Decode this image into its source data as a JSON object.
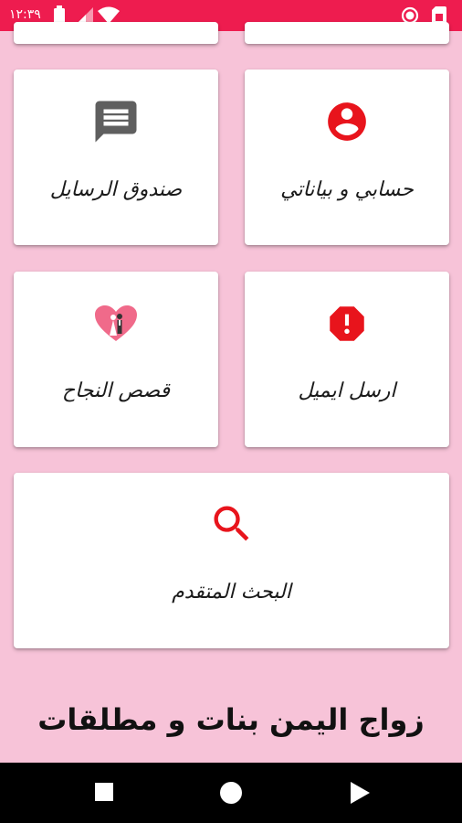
{
  "status_bar": {
    "time": "١٢:٣٩",
    "background": "#ee1c4f"
  },
  "cards": {
    "account": {
      "label": "حسابي و بياناتي",
      "icon": "account-circle-icon",
      "icon_color": "#e8141c"
    },
    "messages": {
      "label": "صندوق الرسايل",
      "icon": "message-icon",
      "icon_color": "#5f5f5f"
    },
    "email": {
      "label": "ارسل ايميل",
      "icon": "report-octagon-icon",
      "icon_color": "#e8141c"
    },
    "stories": {
      "label": "قصص النجاح",
      "icon": "wedding-heart-icon",
      "icon_color": "#f06a8a"
    },
    "search": {
      "label": "البحث المتقدم",
      "icon": "search-icon",
      "icon_color": "#e8141c"
    }
  },
  "app_title": "زواج اليمن بنات و مطلقات",
  "theme": {
    "background": "#f7c3d8",
    "card": "#ffffff",
    "nav_bar": "#000000"
  }
}
